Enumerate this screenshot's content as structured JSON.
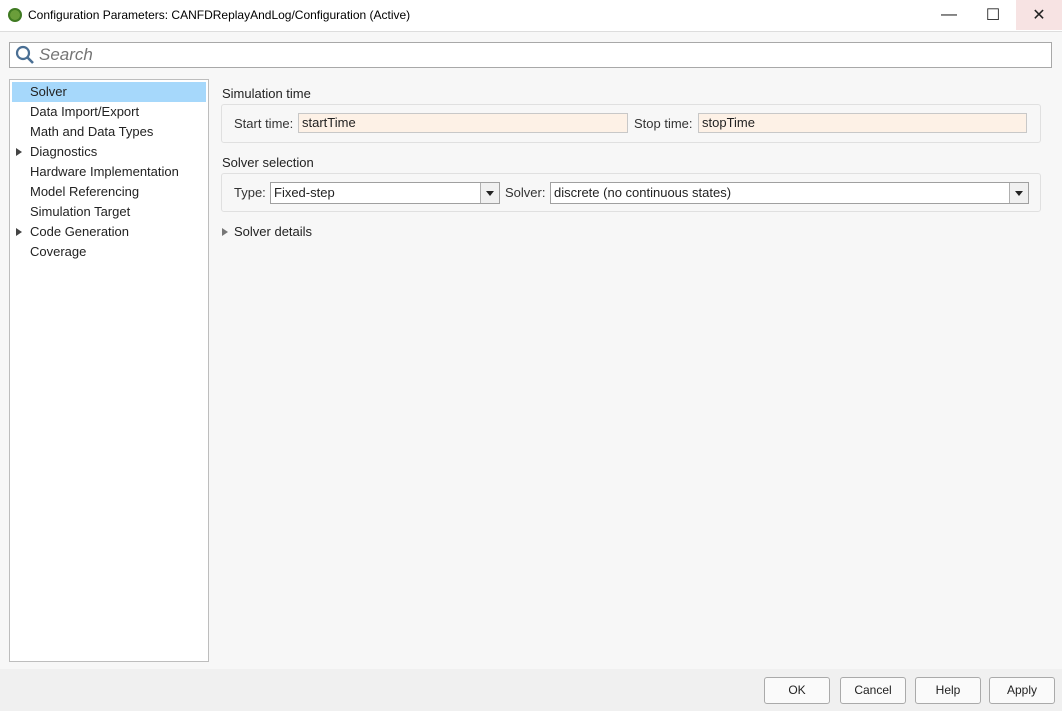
{
  "window": {
    "title": "Configuration Parameters: CANFDReplayAndLog/Configuration (Active)",
    "minimize": "—",
    "maximize": "☐",
    "close": "✕"
  },
  "search": {
    "placeholder": "Search"
  },
  "tree": [
    {
      "label": "Solver",
      "selected": true,
      "expandable": false
    },
    {
      "label": "Data Import/Export"
    },
    {
      "label": "Math and Data Types"
    },
    {
      "label": "Diagnostics",
      "expandable": true
    },
    {
      "label": "Hardware Implementation"
    },
    {
      "label": "Model Referencing"
    },
    {
      "label": "Simulation Target"
    },
    {
      "label": "Code Generation",
      "expandable": true
    },
    {
      "label": "Coverage"
    }
  ],
  "sim_time": {
    "heading": "Simulation time",
    "start_label": "Start time:",
    "start_value": "startTime",
    "stop_label": "Stop time:",
    "stop_value": "stopTime"
  },
  "solver_sel": {
    "heading": "Solver selection",
    "type_label": "Type:",
    "type_value": "Fixed-step",
    "solver_label": "Solver:",
    "solver_value": "discrete (no continuous states)"
  },
  "solver_details": "Solver details",
  "buttons": {
    "ok": "OK",
    "cancel": "Cancel",
    "help": "Help",
    "apply": "Apply"
  }
}
